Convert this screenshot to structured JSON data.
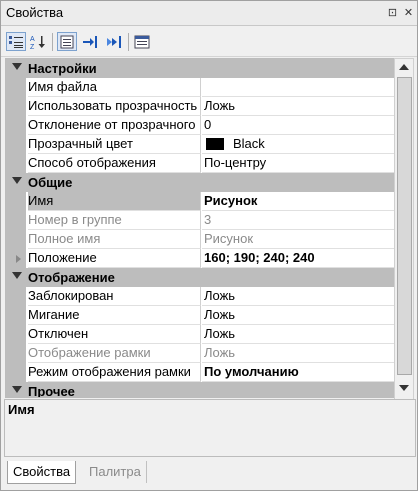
{
  "window": {
    "title": "Свойства",
    "pin_glyph": "⊡",
    "close_glyph": "✕"
  },
  "toolbar": {
    "buttons": [
      {
        "name": "categorized-icon",
        "active": true
      },
      {
        "name": "alphabetical-icon",
        "active": false
      },
      {
        "name": "properties-icon",
        "active": true
      },
      {
        "name": "events-icon",
        "active": false
      },
      {
        "name": "methods-icon",
        "active": false
      },
      {
        "name": "property-pages-icon",
        "active": false
      }
    ]
  },
  "grid": {
    "categories": [
      {
        "label": "Настройки",
        "props": [
          {
            "name": "Имя файла",
            "value": ""
          },
          {
            "name": "Использовать прозрачность",
            "value": "Ложь"
          },
          {
            "name": "Отклонение от прозрачного",
            "value": "0"
          },
          {
            "name": "Прозрачный цвет",
            "value": "Black",
            "swatch": "#000000"
          },
          {
            "name": "Способ отображения",
            "value": "По-центру"
          }
        ]
      },
      {
        "label": "Общие",
        "props": [
          {
            "name": "Имя",
            "value": "Рисунок",
            "bold": true,
            "selected": true
          },
          {
            "name": "Номер в группе",
            "value": "3",
            "dim": true
          },
          {
            "name": "Полное имя",
            "value": "Рисунок",
            "dim": true
          },
          {
            "name": "Положение",
            "value": "160; 190; 240; 240",
            "bold": true,
            "expandable": true
          }
        ]
      },
      {
        "label": "Отображение",
        "props": [
          {
            "name": "Заблокирован",
            "value": "Ложь"
          },
          {
            "name": "Мигание",
            "value": "Ложь"
          },
          {
            "name": "Отключен",
            "value": "Ложь"
          },
          {
            "name": "Отображение рамки",
            "value": "Ложь",
            "dim": true
          },
          {
            "name": "Режим отображения рамки",
            "value": "По умолчанию",
            "bold": true
          }
        ]
      },
      {
        "label": "Прочее",
        "props": []
      }
    ]
  },
  "description": {
    "title": "Имя"
  },
  "tabs": [
    {
      "label": "Свойства",
      "active": true
    },
    {
      "label": "Палитра",
      "active": false
    }
  ],
  "colors": {
    "category_bg": "#bdbdbd",
    "dim_text": "#8a8a8a",
    "toolbar_active": "#dfe8f6"
  }
}
